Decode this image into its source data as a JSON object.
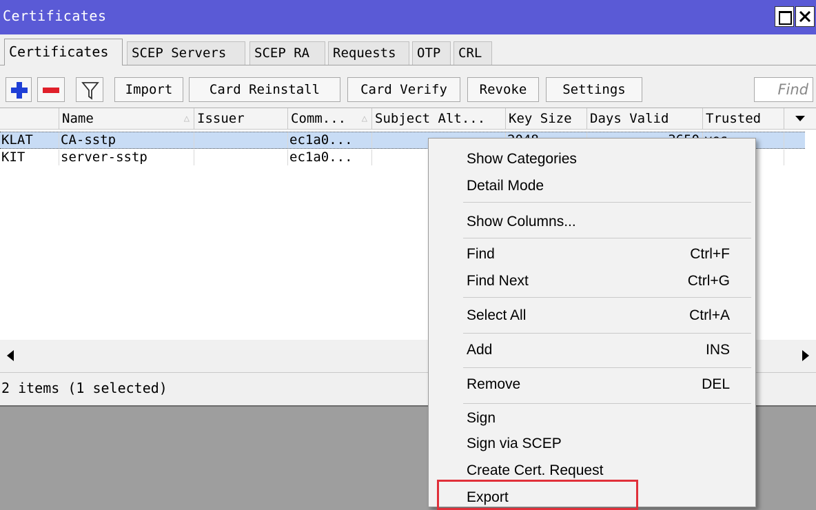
{
  "window": {
    "title": "Certificates"
  },
  "tabs": [
    {
      "label": "Certificates",
      "active": true
    },
    {
      "label": "SCEP Servers"
    },
    {
      "label": "SCEP RA"
    },
    {
      "label": "Requests"
    },
    {
      "label": "OTP"
    },
    {
      "label": "CRL"
    }
  ],
  "toolbar": {
    "add_icon": "plus-icon",
    "remove_icon": "minus-icon",
    "filter_icon": "filter-icon",
    "import_label": "Import",
    "card_reinstall_label": "Card Reinstall",
    "card_verify_label": "Card Verify",
    "revoke_label": "Revoke",
    "settings_label": "Settings",
    "find_placeholder": "Find"
  },
  "table": {
    "columns": [
      "Name",
      "Issuer",
      "Comm...",
      "Subject Alt...",
      "Key Size",
      "Days Valid",
      "Trusted"
    ],
    "rows": [
      {
        "flags": "KLAT",
        "name": "CA-sstp",
        "issuer": "",
        "common": "ec1a0...",
        "subject_alt": "",
        "key_size": "2048",
        "days_valid": "3650",
        "trusted": "yes",
        "selected": true
      },
      {
        "flags": "KIT",
        "name": "server-sstp",
        "issuer": "",
        "common": "ec1a0...",
        "subject_alt": "",
        "key_size": "",
        "days_valid": "",
        "trusted": "",
        "selected": false
      }
    ]
  },
  "status": {
    "text": "2 items (1 selected)"
  },
  "context_menu": {
    "show_categories": "Show Categories",
    "detail_mode": "Detail Mode",
    "show_columns": "Show Columns...",
    "find": "Find",
    "find_shortcut": "Ctrl+F",
    "find_next": "Find Next",
    "find_next_shortcut": "Ctrl+G",
    "select_all": "Select All",
    "select_all_shortcut": "Ctrl+A",
    "add": "Add",
    "add_shortcut": "INS",
    "remove": "Remove",
    "remove_shortcut": "DEL",
    "sign": "Sign",
    "sign_via_scep": "Sign via SCEP",
    "create_cert_request": "Create Cert. Request",
    "export": "Export"
  },
  "colors": {
    "titlebar": "#5a5ad6",
    "selected_row": "#c8dcf5",
    "highlight_box": "#e0303a",
    "add_icon": "#1f3fd6",
    "remove_icon": "#e0202a"
  }
}
